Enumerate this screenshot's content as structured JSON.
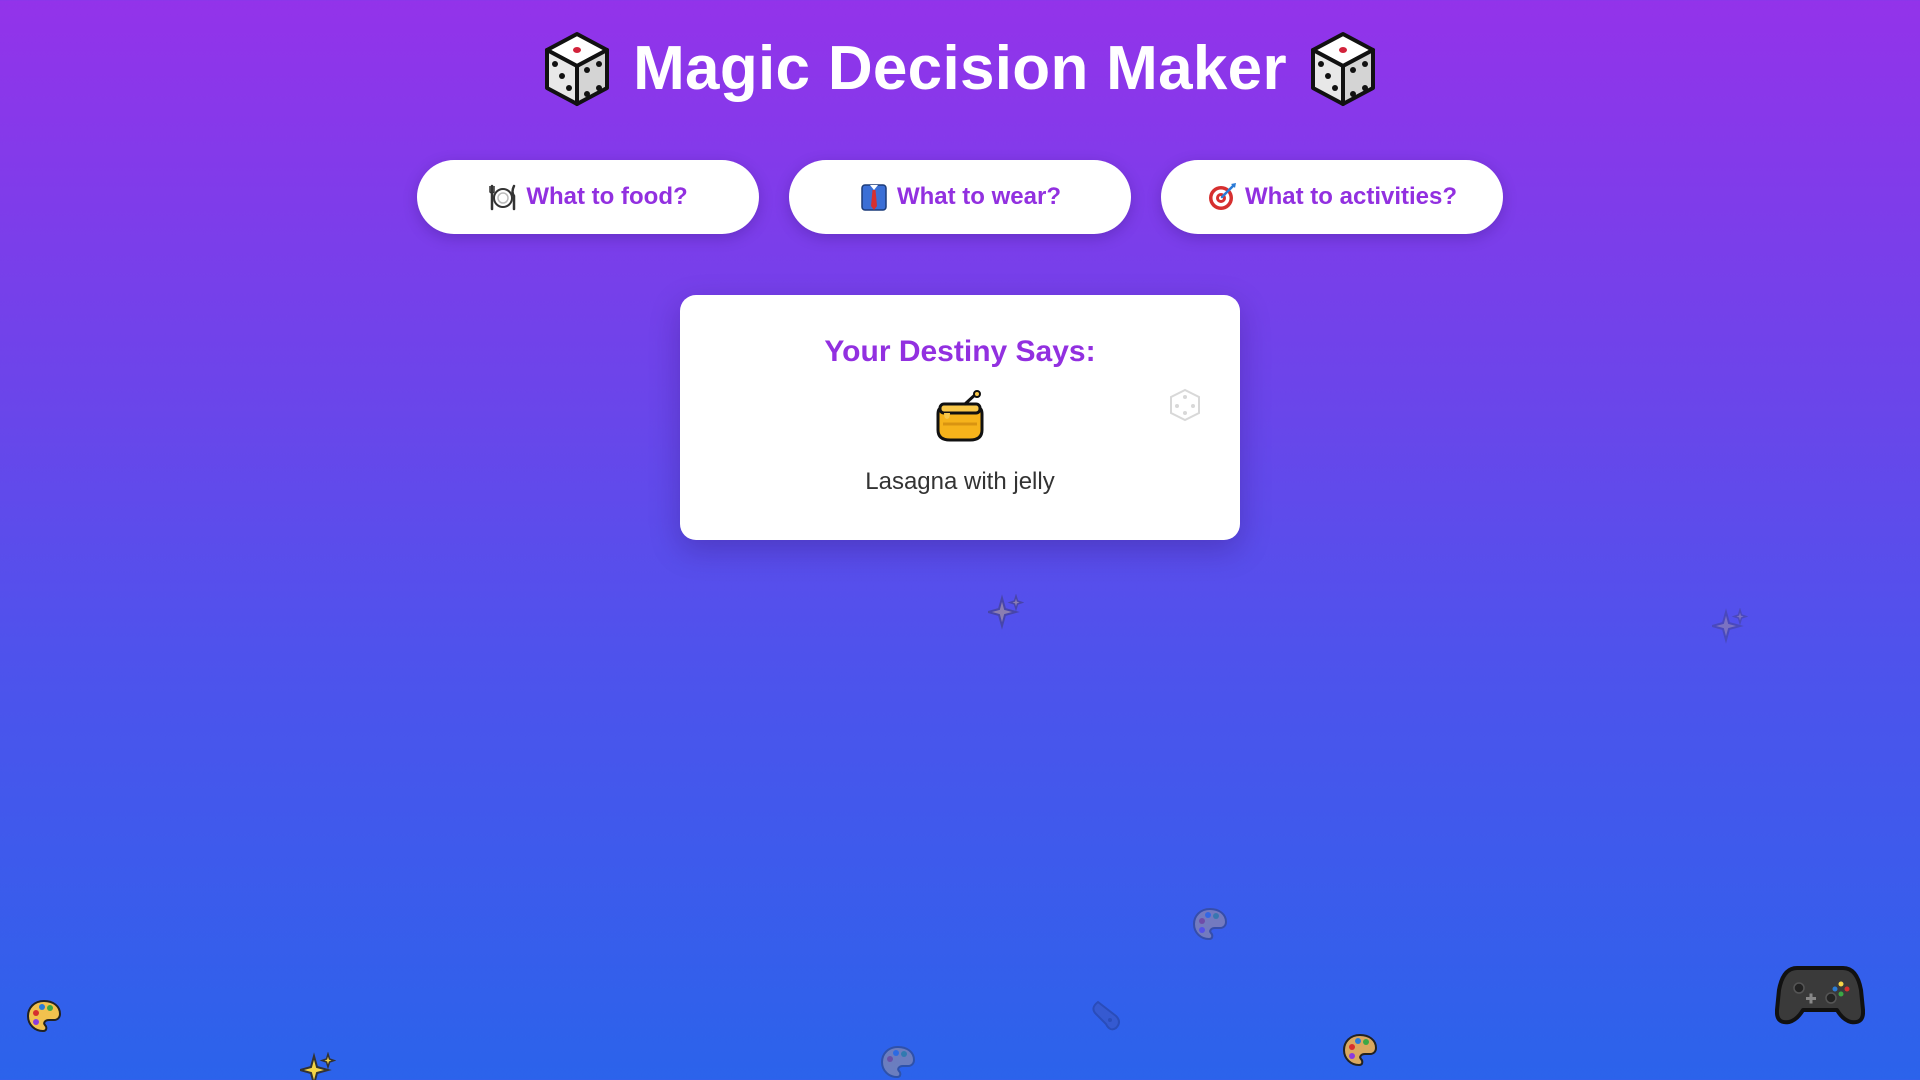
{
  "header": {
    "title": "Magic Decision Maker",
    "left_icon": "game-die-icon",
    "right_icon": "game-die-icon"
  },
  "categories": [
    {
      "label": "What to food?",
      "icon": "fork-knife-plate-icon"
    },
    {
      "label": "What to wear?",
      "icon": "shirt-tie-icon"
    },
    {
      "label": "What to activities?",
      "icon": "direct-hit-target-icon"
    }
  ],
  "result": {
    "heading": "Your Destiny Says:",
    "emoji": "honey-pot-icon",
    "text": "Lasagna with jelly"
  },
  "decorations": [
    "game-die-icon",
    "sparkles-icon",
    "artist-palette-icon",
    "video-game-controller-icon"
  ],
  "colors": {
    "accent": "#9230e0",
    "gradient_top": "#9333ea",
    "gradient_bottom": "#2b63eb",
    "card_bg": "#ffffff"
  }
}
